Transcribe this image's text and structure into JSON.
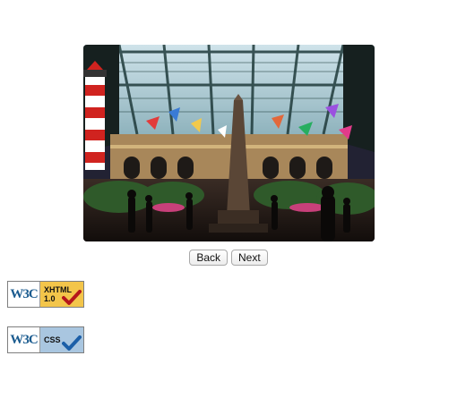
{
  "gallery": {
    "image_description": "Indoor conservatory garden under a glass ceiling",
    "back_label": "Back",
    "next_label": "Next"
  },
  "badges": [
    {
      "org": "W3C",
      "line1": "XHTML",
      "line2": "1.0",
      "color": "#f3c54a",
      "check_color": "#b5161b"
    },
    {
      "org": "W3C",
      "line1": "CSS",
      "line2": "",
      "color": "#a9c6e0",
      "check_color": "#1c5fa8"
    }
  ]
}
